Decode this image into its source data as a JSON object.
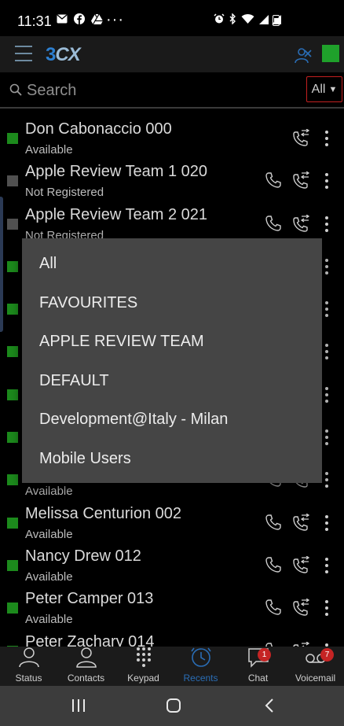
{
  "status_bar": {
    "time": "11:31",
    "left_icons": [
      "mail-icon",
      "facebook-icon",
      "drive-icon"
    ],
    "more": "···",
    "right_icons": [
      "alarm-icon",
      "bluetooth-icon",
      "wifi-icon",
      "signal-icon"
    ]
  },
  "app": {
    "logo_part1": "3",
    "logo_part2": "CX",
    "presence_color": "#1fa12b"
  },
  "search": {
    "placeholder": "Search",
    "filter_value": "All"
  },
  "contacts": [
    {
      "name": "Don Cabonaccio 000",
      "state": "Available",
      "status": "available",
      "has_call": false
    },
    {
      "name": "Apple Review Team 1 020",
      "state": "Not Registered",
      "status": "notreg",
      "has_call": true
    },
    {
      "name": "Apple Review Team 2 021",
      "state": "Not Registered",
      "status": "notreg",
      "has_call": true
    },
    {
      "name": "",
      "state": "",
      "status": "available",
      "has_call": true
    },
    {
      "name": "",
      "state": "",
      "status": "available",
      "has_call": true
    },
    {
      "name": "",
      "state": "",
      "status": "available",
      "has_call": true
    },
    {
      "name": "",
      "state": "",
      "status": "available",
      "has_call": true
    },
    {
      "name": "",
      "state": "",
      "status": "available",
      "has_call": true
    },
    {
      "name": "",
      "state": "Available",
      "status": "available",
      "has_call": true
    },
    {
      "name": "Melissa Centurion 002",
      "state": "Available",
      "status": "available",
      "has_call": true
    },
    {
      "name": "Nancy Drew 012",
      "state": "Available",
      "status": "available",
      "has_call": true
    },
    {
      "name": "Peter Camper 013",
      "state": "Available",
      "status": "available",
      "has_call": true
    },
    {
      "name": "Peter Zachary 014",
      "state": "",
      "status": "available",
      "has_call": true
    }
  ],
  "dropdown": {
    "options": [
      "All",
      "FAVOURITES",
      "APPLE REVIEW TEAM",
      "DEFAULT",
      "Development@Italy - Milan",
      "Mobile Users"
    ]
  },
  "tabs": [
    {
      "label": "Status",
      "icon": "person-icon",
      "active": false
    },
    {
      "label": "Contacts",
      "icon": "contacts-icon",
      "active": false
    },
    {
      "label": "Keypad",
      "icon": "keypad-icon",
      "active": false
    },
    {
      "label": "Recents",
      "icon": "clock-icon",
      "active": true
    },
    {
      "label": "Chat",
      "icon": "chat-icon",
      "active": false,
      "badge": "1"
    },
    {
      "label": "Voicemail",
      "icon": "voicemail-icon",
      "active": false,
      "badge": "7"
    }
  ],
  "colors": {
    "available": "#1c8a1c",
    "not_registered": "#505050",
    "accent": "#2a6db5",
    "badge": "#c52424"
  }
}
